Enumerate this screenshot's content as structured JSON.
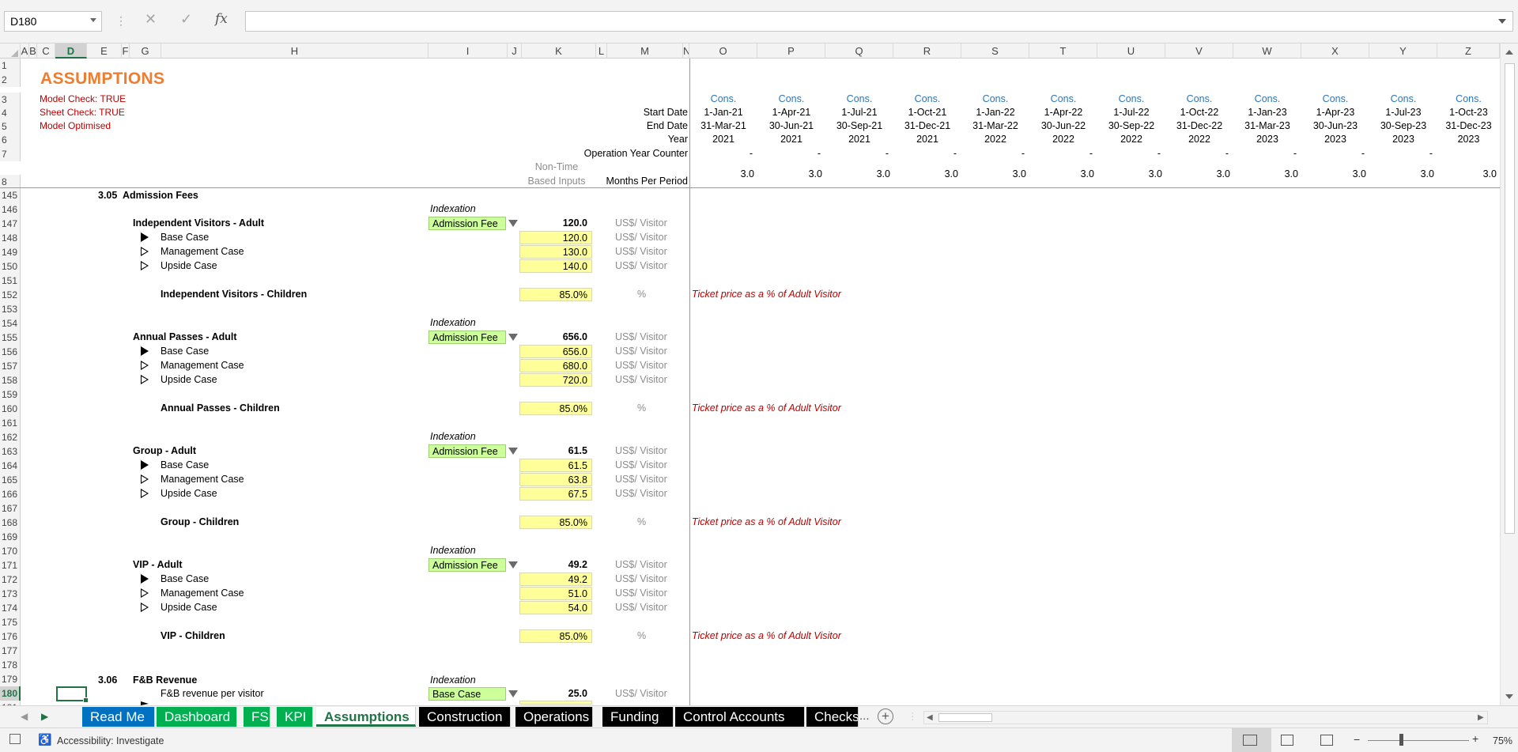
{
  "formula_bar": {
    "name_box": "D180",
    "formula": "",
    "fx_label": "fx"
  },
  "columns": [
    "A",
    "B",
    "C",
    "D",
    "E",
    "F",
    "G",
    "H",
    "I",
    "J",
    "K",
    "L",
    "M",
    "N",
    "O",
    "P",
    "Q",
    "R",
    "S",
    "T",
    "U",
    "V",
    "W",
    "X",
    "Y",
    "Z"
  ],
  "selected_column": "D",
  "selected_row": "180",
  "top_rows": [
    "1",
    "2",
    "3",
    "4",
    "5",
    "6",
    "7",
    "8"
  ],
  "header": {
    "title": "ASSUMPTIONS",
    "checks": [
      "Model Check: TRUE",
      "Sheet Check: TRUE",
      "Model Optimised"
    ],
    "row_labels": {
      "start_date": "Start Date",
      "end_date": "End Date",
      "year": "Year",
      "op_counter": "Operation Year Counter",
      "months": "Months Per Period",
      "non_time_1": "Non-Time",
      "non_time_2": "Based Inputs"
    }
  },
  "timeline": [
    {
      "col": "O",
      "status": "Cons.",
      "start": "1-Jan-21",
      "end": "31-Mar-21",
      "year": "2021",
      "counter": "-",
      "months": "3.0"
    },
    {
      "col": "P",
      "status": "Cons.",
      "start": "1-Apr-21",
      "end": "30-Jun-21",
      "year": "2021",
      "counter": "-",
      "months": "3.0"
    },
    {
      "col": "Q",
      "status": "Cons.",
      "start": "1-Jul-21",
      "end": "30-Sep-21",
      "year": "2021",
      "counter": "-",
      "months": "3.0"
    },
    {
      "col": "R",
      "status": "Cons.",
      "start": "1-Oct-21",
      "end": "31-Dec-21",
      "year": "2021",
      "counter": "-",
      "months": "3.0"
    },
    {
      "col": "S",
      "status": "Cons.",
      "start": "1-Jan-22",
      "end": "31-Mar-22",
      "year": "2022",
      "counter": "-",
      "months": "3.0"
    },
    {
      "col": "T",
      "status": "Cons.",
      "start": "1-Apr-22",
      "end": "30-Jun-22",
      "year": "2022",
      "counter": "-",
      "months": "3.0"
    },
    {
      "col": "U",
      "status": "Cons.",
      "start": "1-Jul-22",
      "end": "30-Sep-22",
      "year": "2022",
      "counter": "-",
      "months": "3.0"
    },
    {
      "col": "V",
      "status": "Cons.",
      "start": "1-Oct-22",
      "end": "31-Dec-22",
      "year": "2022",
      "counter": "-",
      "months": "3.0"
    },
    {
      "col": "W",
      "status": "Cons.",
      "start": "1-Jan-23",
      "end": "31-Mar-23",
      "year": "2023",
      "counter": "-",
      "months": "3.0"
    },
    {
      "col": "X",
      "status": "Cons.",
      "start": "1-Apr-23",
      "end": "30-Jun-23",
      "year": "2023",
      "counter": "-",
      "months": "3.0"
    },
    {
      "col": "Y",
      "status": "Cons.",
      "start": "1-Jul-23",
      "end": "30-Sep-23",
      "year": "2023",
      "counter": "-",
      "months": "3.0"
    },
    {
      "col": "Z",
      "status": "Cons.",
      "start": "1-Oct-23",
      "end": "31-Dec-23",
      "year": "2023",
      "counter": "",
      "months": "3.0"
    }
  ],
  "body_rows": [
    "145",
    "146",
    "147",
    "148",
    "149",
    "150",
    "151",
    "152",
    "153",
    "154",
    "155",
    "156",
    "157",
    "158",
    "159",
    "160",
    "161",
    "162",
    "163",
    "164",
    "165",
    "166",
    "167",
    "168",
    "169",
    "170",
    "171",
    "172",
    "173",
    "174",
    "175",
    "176",
    "177",
    "178",
    "179",
    "180",
    "181"
  ],
  "sections": {
    "s305": {
      "number": "3.05",
      "title": "Admission Fees"
    },
    "s306": {
      "number": "3.06",
      "title": "F&B Revenue"
    }
  },
  "labels": {
    "indexation": "Indexation",
    "base_case": "Base Case",
    "management_case": "Management Case",
    "upside_case": "Upside Case",
    "unit_visitor": "US$/ Visitor",
    "unit_pct": "%",
    "note_pct_adult": "Ticket price as a % of Adult Visitor"
  },
  "groups": [
    {
      "name": "Independent Visitors - Adult",
      "index": "Admission Fee",
      "value": "120.0",
      "base": "120.0",
      "mgmt": "130.0",
      "upside": "140.0",
      "child_name": "Independent Visitors - Children",
      "child_pct": "85.0%"
    },
    {
      "name": "Annual Passes - Adult",
      "index": "Admission Fee",
      "value": "656.0",
      "base": "656.0",
      "mgmt": "680.0",
      "upside": "720.0",
      "child_name": "Annual Passes - Children",
      "child_pct": "85.0%"
    },
    {
      "name": "Group - Adult",
      "index": "Admission Fee",
      "value": "61.5",
      "base": "61.5",
      "mgmt": "63.8",
      "upside": "67.5",
      "child_name": "Group - Children",
      "child_pct": "85.0%"
    },
    {
      "name": "VIP - Adult",
      "index": "Admission Fee",
      "value": "49.2",
      "base": "49.2",
      "mgmt": "51.0",
      "upside": "54.0",
      "child_name": "VIP - Children",
      "child_pct": "85.0%"
    }
  ],
  "fb": {
    "label": "F&B revenue per visitor",
    "index": "Base Case",
    "value": "25.0"
  },
  "tabs": [
    {
      "label": "Read Me",
      "color": "#0070c0"
    },
    {
      "label": "Dashboard",
      "color": "#00b050"
    },
    {
      "label": "FS",
      "color": "#00b050"
    },
    {
      "label": "KPI",
      "color": "#00b050"
    },
    {
      "label": "Assumptions",
      "color": "#ffffff",
      "active": true
    },
    {
      "label": "Construction",
      "color": "#000000"
    },
    {
      "label": "Operations",
      "color": "#000000"
    },
    {
      "label": "Funding",
      "color": "#000000"
    },
    {
      "label": "Control Accounts",
      "color": "#000000"
    },
    {
      "label": "Checks",
      "color": "#000000"
    }
  ],
  "tab_more": "...",
  "status": {
    "accessibility": "Accessibility: Investigate",
    "zoom": "75%"
  }
}
